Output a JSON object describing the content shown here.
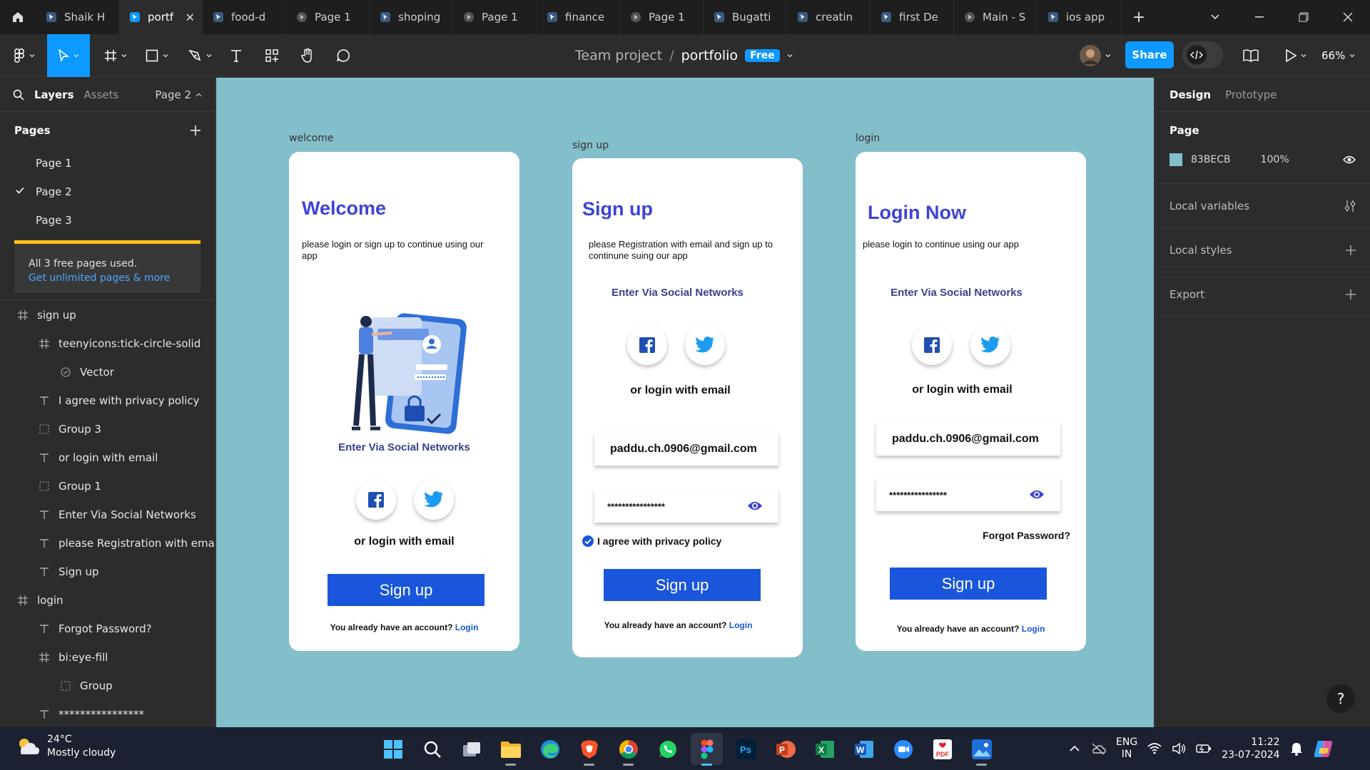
{
  "tabs": [
    {
      "title": "Shaik H",
      "type": "design",
      "active": false
    },
    {
      "title": "portf",
      "type": "design",
      "active": true
    },
    {
      "title": "food-d",
      "type": "design",
      "active": false
    },
    {
      "title": "Page 1",
      "type": "proto",
      "active": false
    },
    {
      "title": "shoping",
      "type": "design",
      "active": false
    },
    {
      "title": "Page 1",
      "type": "proto",
      "active": false
    },
    {
      "title": "finance",
      "type": "design",
      "active": false
    },
    {
      "title": "Page 1",
      "type": "proto",
      "active": false
    },
    {
      "title": "Bugatti",
      "type": "design",
      "active": false
    },
    {
      "title": "creatin",
      "type": "design",
      "active": false
    },
    {
      "title": "first De",
      "type": "design",
      "active": false
    },
    {
      "title": "Main - S",
      "type": "proto",
      "active": false
    },
    {
      "title": "ios app",
      "type": "design",
      "active": false
    }
  ],
  "toolbar": {
    "team": "Team project",
    "separator": "/",
    "file_name": "portfolio",
    "plan_badge": "Free",
    "share_label": "Share",
    "zoom": "66%"
  },
  "left_panel": {
    "tab_layers": "Layers",
    "tab_assets": "Assets",
    "current_page": "Page 2",
    "pages_heading": "Pages",
    "pages": [
      "Page 1",
      "Page 2",
      "Page 3"
    ],
    "selected_page_index": 1,
    "upsell_text": "All 3 free pages used.",
    "upsell_link": "Get unlimited pages & more",
    "layers": [
      {
        "name": "sign up",
        "icon": "frame",
        "depth": 0
      },
      {
        "name": "teenyicons:tick-circle-solid",
        "icon": "frame",
        "depth": 1
      },
      {
        "name": "Vector",
        "icon": "vector",
        "depth": 2
      },
      {
        "name": "I agree with privacy policy",
        "icon": "text",
        "depth": 1
      },
      {
        "name": "Group 3",
        "icon": "group",
        "depth": 1
      },
      {
        "name": "or login with email",
        "icon": "text",
        "depth": 1
      },
      {
        "name": "Group 1",
        "icon": "group",
        "depth": 1
      },
      {
        "name": "Enter Via Social Networks",
        "icon": "text",
        "depth": 1
      },
      {
        "name": "please Registration with email...",
        "icon": "text",
        "depth": 1
      },
      {
        "name": "Sign up",
        "icon": "text",
        "depth": 1
      },
      {
        "name": "login",
        "icon": "frame",
        "depth": 0
      },
      {
        "name": "Forgot Password?",
        "icon": "text",
        "depth": 1
      },
      {
        "name": "bi:eye-fill",
        "icon": "frame",
        "depth": 1
      },
      {
        "name": "Group",
        "icon": "group",
        "depth": 2
      },
      {
        "name": "****************",
        "icon": "text",
        "depth": 1
      }
    ]
  },
  "canvas": {
    "background": "#83BECB",
    "welcome": {
      "label": "welcome",
      "title": "Welcome",
      "description": "please login or sign up to continue using our app",
      "social_title": "Enter Via Social Networks",
      "or_login": "or login with email",
      "button": "Sign up",
      "account_text": "You already have an account?",
      "login_link": "Login"
    },
    "signup": {
      "label": "sign up",
      "title": "Sign up",
      "description": "please  Registration with email and sign up to continune suing our app",
      "social_title": "Enter Via Social Networks",
      "or_login": "or login with email",
      "email": "paddu.ch.0906@gmail.com",
      "password": "****************",
      "agree": "I agree with privacy policy",
      "button": "Sign up",
      "account_text": "You already have an account?",
      "login_link": "Login"
    },
    "login": {
      "label": "login",
      "title": "Login Now",
      "description": "please login  to continue using our app",
      "social_title": "Enter Via Social Networks",
      "or_login": "or login with email",
      "email": "paddu.ch.0906@gmail.com",
      "password": "****************",
      "forgot": "Forgot Password?",
      "button": "Sign up",
      "account_text": "You already have an account?",
      "login_link": "Login"
    }
  },
  "right_panel": {
    "tab_design": "Design",
    "tab_prototype": "Prototype",
    "page_heading": "Page",
    "page_color": "83BECB",
    "page_opacity": "100%",
    "local_variables": "Local variables",
    "local_styles": "Local styles",
    "export": "Export",
    "help": "?"
  },
  "taskbar": {
    "temperature": "24°C",
    "weather": "Mostly cloudy",
    "lang_line1": "ENG",
    "lang_line2": "IN",
    "time": "11:22",
    "date": "23-07-2024"
  },
  "colors": {
    "accent": "#0d99ff",
    "primary_button": "#1a56db",
    "heading": "#3d44d6",
    "upsell_bar": "#ffc21a"
  }
}
